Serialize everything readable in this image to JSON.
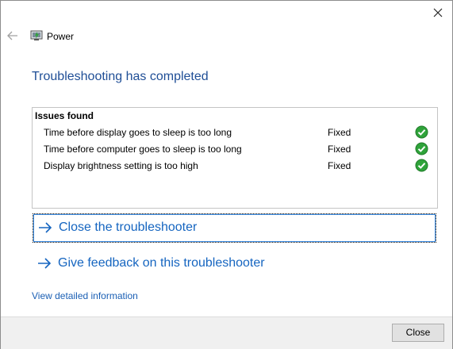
{
  "window": {
    "title": "Power",
    "close_icon": "close-icon",
    "back_icon": "back-arrow-icon",
    "app_icon": "power-troubleshooter-icon"
  },
  "main": {
    "heading": "Troubleshooting has completed",
    "issues": {
      "header": "Issues found",
      "rows": [
        {
          "issue": "Time before display goes to sleep is too long",
          "status": "Fixed",
          "icon": "check-icon"
        },
        {
          "issue": "Time before computer goes to sleep is too long",
          "status": "Fixed",
          "icon": "check-icon"
        },
        {
          "issue": "Display brightness setting is too high",
          "status": "Fixed",
          "icon": "check-icon"
        }
      ]
    },
    "actions": {
      "close_troubleshooter": "Close the troubleshooter",
      "give_feedback": "Give feedback on this troubleshooter"
    },
    "detail_link": "View detailed information"
  },
  "footer": {
    "close_label": "Close"
  },
  "colors": {
    "heading": "#1f4e96",
    "link": "#1565c0",
    "check": "#2fa33a",
    "footer_bg": "#f0f0f0"
  }
}
